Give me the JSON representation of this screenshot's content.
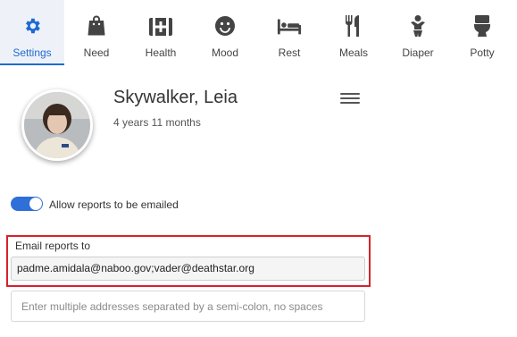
{
  "tabs": [
    {
      "label": "Settings",
      "icon": "gear-icon",
      "active": true
    },
    {
      "label": "Need",
      "icon": "bag-icon"
    },
    {
      "label": "Health",
      "icon": "medical-kit-icon"
    },
    {
      "label": "Mood",
      "icon": "smiley-icon"
    },
    {
      "label": "Rest",
      "icon": "bed-icon"
    },
    {
      "label": "Meals",
      "icon": "fork-knife-icon"
    },
    {
      "label": "Diaper",
      "icon": "baby-icon"
    },
    {
      "label": "Potty",
      "icon": "toilet-icon"
    }
  ],
  "profile": {
    "name": "Skywalker, Leia",
    "age": "4 years 11 months"
  },
  "email_toggle": {
    "label": "Allow reports to be emailed",
    "on": true
  },
  "email": {
    "label": "Email reports to",
    "value": "padme.amidala@naboo.gov;vader@deathstar.org",
    "hint_placeholder": "Enter multiple addresses separated by a semi-colon, no spaces"
  },
  "colors": {
    "accent": "#1e6ad3",
    "highlight_border": "#d6222a",
    "icon": "#444444"
  }
}
